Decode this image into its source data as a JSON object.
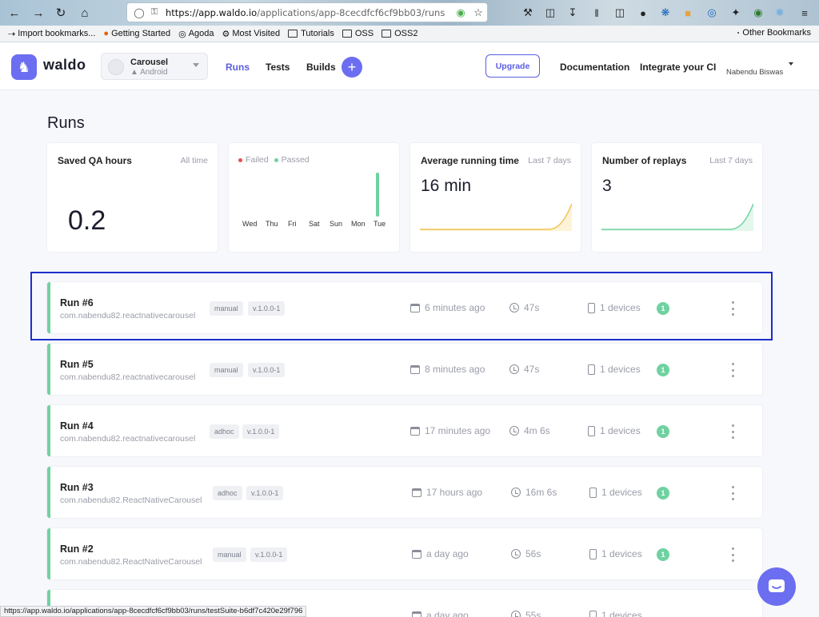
{
  "browser": {
    "url_host": "https://app.waldo.io",
    "url_path": "/applications/app-8cecdfcf6cf9bb03/runs",
    "bookmarks": [
      {
        "label": "Import bookmarks...",
        "icon": "import-icon"
      },
      {
        "label": "Getting Started",
        "icon": "firefox-icon"
      },
      {
        "label": "Agoda",
        "icon": "globe-icon"
      },
      {
        "label": "Most Visited",
        "icon": "gear-icon"
      },
      {
        "label": "Tutorials",
        "icon": "folder-icon"
      },
      {
        "label": "OSS",
        "icon": "folder-icon"
      },
      {
        "label": "OSS2",
        "icon": "folder-icon"
      }
    ],
    "other_bookmarks": "Other Bookmarks",
    "status_url": "https://app.waldo.io/applications/app-8cecdfcf6cf9bb03/runs/testSuite-b6df7c420e29f796"
  },
  "header": {
    "logo_text": "waldo",
    "app_name": "Carousel",
    "app_platform": "Android",
    "nav": {
      "runs": "Runs",
      "tests": "Tests",
      "builds": "Builds"
    },
    "plus": "+",
    "upgrade": "Upgrade",
    "documentation": "Documentation",
    "integrate": "Integrate your CI",
    "user": "Nabendu Biswas",
    "accent": "#6b6ef0"
  },
  "page": {
    "title": "Runs"
  },
  "stats": {
    "saved": {
      "label": "Saved QA hours",
      "period": "All time",
      "value": "0.2"
    },
    "results": {
      "failed": "Failed",
      "passed": "Passed",
      "days": [
        "Wed",
        "Thu",
        "Fri",
        "Sat",
        "Sun",
        "Mon",
        "Tue"
      ]
    },
    "avg": {
      "label": "Average running time",
      "period": "Last 7 days",
      "value": "16 min"
    },
    "replays": {
      "label": "Number of replays",
      "period": "Last 7 days",
      "value": "3"
    }
  },
  "runs": [
    {
      "title": "Run #6",
      "pkg": "com.nabendu82.reactnativecarousel",
      "type": "manual",
      "version": "v.1.0.0-1",
      "time": "6 minutes ago",
      "duration": "47s",
      "devices": "1 devices",
      "count": "1"
    },
    {
      "title": "Run #5",
      "pkg": "com.nabendu82.reactnativecarousel",
      "type": "manual",
      "version": "v.1.0.0-1",
      "time": "8 minutes ago",
      "duration": "47s",
      "devices": "1 devices",
      "count": "1"
    },
    {
      "title": "Run #4",
      "pkg": "com.nabendu82.reactnativecarousel",
      "type": "adhoc",
      "version": "v.1.0.0-1",
      "time": "17 minutes ago",
      "duration": "4m 6s",
      "devices": "1 devices",
      "count": "1"
    },
    {
      "title": "Run #3",
      "pkg": "com.nabendu82.ReactNativeCarousel",
      "type": "adhoc",
      "version": "v.1.0.0-1",
      "time": "17 hours ago",
      "duration": "16m 6s",
      "devices": "1 devices",
      "count": "1"
    },
    {
      "title": "Run #2",
      "pkg": "com.nabendu82.ReactNativeCarousel",
      "type": "manual",
      "version": "v.1.0.0-1",
      "time": "a day ago",
      "duration": "56s",
      "devices": "1 devices",
      "count": "1"
    },
    {
      "time": "a day ago",
      "duration": "55s",
      "devices": "1 devices"
    }
  ]
}
